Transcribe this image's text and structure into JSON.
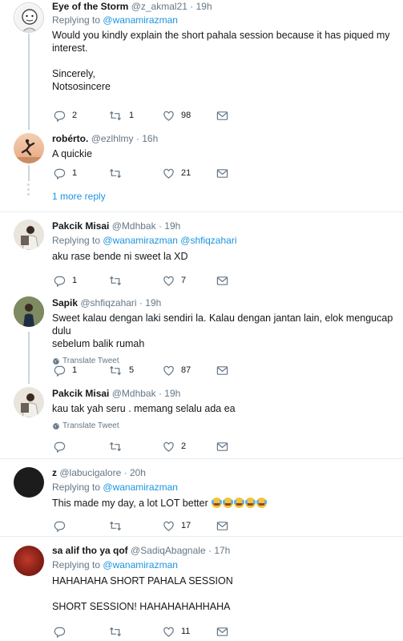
{
  "reply_prefix": "Replying to",
  "translate_label": "Translate Tweet",
  "more_replies": "1 more reply",
  "tweets": [
    {
      "name": "Eye of the Storm",
      "handle": "@z_akmal21",
      "time": "19h",
      "replying": "@wanamirazman",
      "lines": [
        "Would you kindly explain the short pahala session because it has piqued my",
        "interest.",
        "",
        "Sincerely,",
        "Notsosincere"
      ],
      "replies": "2",
      "retweets": "1",
      "likes": "98"
    },
    {
      "name": "robérto.",
      "handle": "@ezlhlmy",
      "time": "16h",
      "lines": [
        "A quickie"
      ],
      "replies": "1",
      "retweets": "",
      "likes": "21"
    },
    {
      "name": "Pakcik Misai",
      "handle": "@Mdhbak",
      "time": "19h",
      "replying": "@wanamirazman",
      "replying2": "@shfiqzahari",
      "lines": [
        "aku rase bende ni sweet la XD"
      ],
      "replies": "1",
      "retweets": "",
      "likes": "7"
    },
    {
      "name": "Sapik",
      "handle": "@shfiqzahari",
      "time": "19h",
      "lines": [
        "Sweet kalau dengan laki sendiri la. Kalau dengan jantan lain, elok mengucap dulu",
        "sebelum balik rumah"
      ],
      "replies": "1",
      "retweets": "5",
      "likes": "87"
    },
    {
      "name": "Pakcik Misai",
      "handle": "@Mdhbak",
      "time": "19h",
      "lines": [
        "kau tak yah seru . memang selalu ada ea"
      ],
      "replies": "",
      "retweets": "",
      "likes": "2"
    },
    {
      "name": "z",
      "handle": "@labucigalore",
      "time": "20h",
      "replying": "@wanamirazman",
      "lines": [
        "This made my day, a lot LOT better"
      ],
      "replies": "",
      "retweets": "",
      "likes": "17"
    },
    {
      "name": "sa alif tho ya qof",
      "handle": "@SadiqAbagnale",
      "time": "17h",
      "replying": "@wanamirazman",
      "lines": [
        "HAHAHAHA SHORT PAHALA SESSION",
        "",
        "SHORT SESSION! HAHAHAHAHHAHA"
      ],
      "replies": "",
      "retweets": "",
      "likes": "11"
    }
  ]
}
